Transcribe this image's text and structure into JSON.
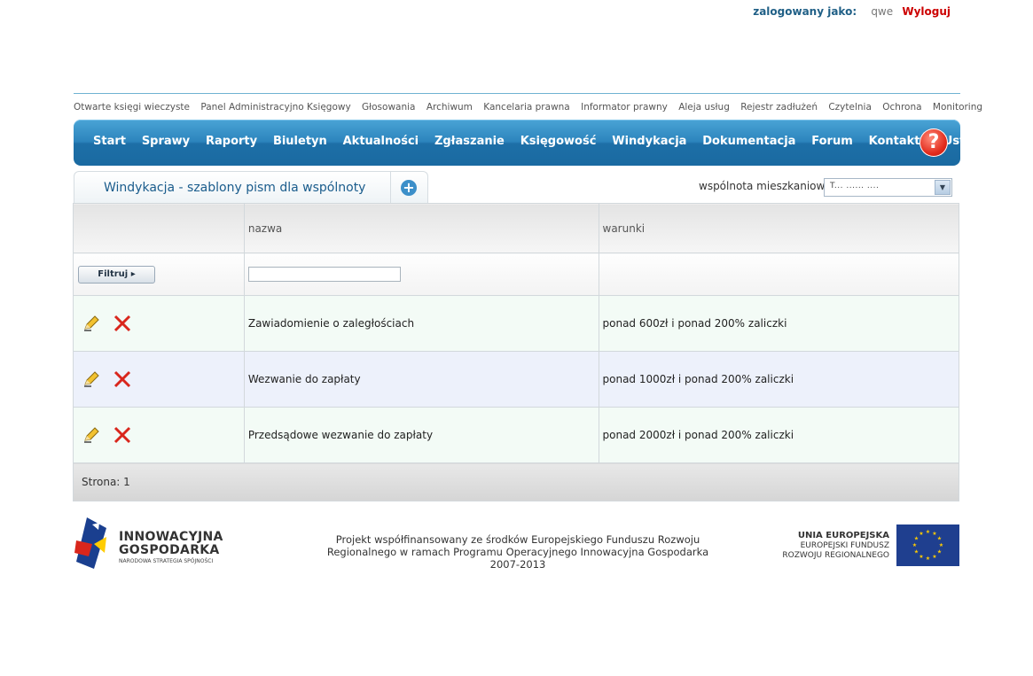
{
  "login": {
    "label": "zalogowany jako:",
    "user": "qwe",
    "logout": "Wyloguj"
  },
  "subnav": [
    "Otwarte księgi wieczyste",
    "Panel Administracyjno Księgowy",
    "Głosowania",
    "Archiwum",
    "Kancelaria prawna",
    "Informator prawny",
    "Aleja usług",
    "Rejestr zadłużeń",
    "Czytelnia",
    "Ochrona",
    "Monitoring"
  ],
  "mainnav": [
    "Start",
    "Sprawy",
    "Raporty",
    "Biuletyn",
    "Aktualności",
    "Zgłaszanie",
    "Księgowość",
    "Windykacja",
    "Dokumentacja",
    "Forum",
    "Kontakty",
    "Ustawienia"
  ],
  "help_icon": "?",
  "tab": {
    "title": "Windykacja - szablony pism dla wspólnoty",
    "add_icon": "+"
  },
  "community": {
    "label": "wspólnota mieszkaniowa:",
    "selected": "T... ...... ....",
    "arrow": "▼"
  },
  "table": {
    "headers": {
      "name": "nazwa",
      "conditions": "warunki"
    },
    "filter_label": "Filtruj ▸",
    "rows": [
      {
        "name": "Zawiadomienie o zaległościach",
        "conditions": "ponad 600zł i ponad 200% zaliczki"
      },
      {
        "name": "Wezwanie do zapłaty",
        "conditions": "ponad 1000zł i ponad 200% zaliczki"
      },
      {
        "name": "Przedsądowe wezwanie do zapłaty",
        "conditions": "ponad 2000zł i ponad 200% zaliczki"
      }
    ],
    "page": "Strona: 1"
  },
  "footer": {
    "logo_line1": "INNOWACYJNA",
    "logo_line2": "GOSPODARKA",
    "logo_line3": "NARODOWA STRATEGIA SPÓJNOŚCI",
    "project_text": "Projekt współfinansowany ze środków Europejskiego Funduszu Rozwoju Regionalnego w ramach Programu Operacyjnego Innowacyjna Gospodarka 2007-2013",
    "eu_line1": "UNIA EUROPEJSKA",
    "eu_line2": "EUROPEJSKI FUNDUSZ",
    "eu_line3": "ROZWOJU REGIONALNEGO"
  },
  "colors": {
    "nav_blue": "#2c84bd",
    "logout_red": "#cc0000",
    "row_green": "#f3fbf6",
    "row_blue": "#edf1fb"
  }
}
